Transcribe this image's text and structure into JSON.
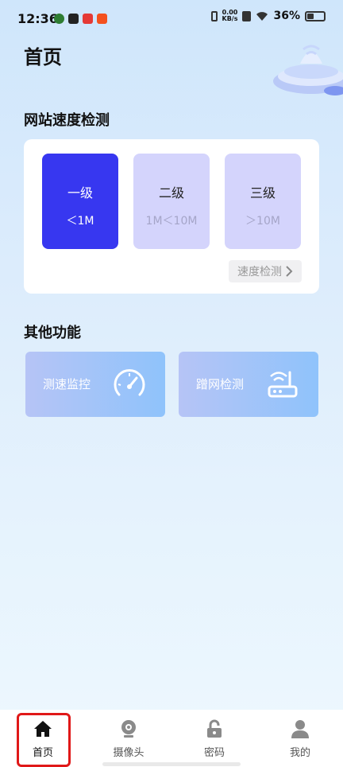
{
  "status_bar": {
    "time": "12:36",
    "net_speed_value": "0.00",
    "net_speed_unit": "KB/s",
    "battery_percent": "36%"
  },
  "page": {
    "title": "首页"
  },
  "speed_section": {
    "title": "网站速度检测",
    "levels": [
      {
        "name": "一级",
        "range": "＜1M"
      },
      {
        "name": "二级",
        "range": "1M＜10M"
      },
      {
        "name": "三级",
        "range": "＞10M"
      }
    ],
    "selected_index": 0,
    "test_button": "速度检测"
  },
  "other_section": {
    "title": "其他功能",
    "items": [
      {
        "label": "测速监控",
        "icon": "speedometer-icon"
      },
      {
        "label": "蹭网检测",
        "icon": "router-icon"
      }
    ]
  },
  "tabbar": {
    "items": [
      {
        "label": "首页",
        "icon": "home-icon"
      },
      {
        "label": "摄像头",
        "icon": "camera-icon"
      },
      {
        "label": "密码",
        "icon": "lock-icon"
      },
      {
        "label": "我的",
        "icon": "user-icon"
      }
    ],
    "active_index": 0
  },
  "colors": {
    "accent": "#3737f0",
    "level_inactive": "#d4d4fc",
    "highlight_border": "#e01818"
  }
}
